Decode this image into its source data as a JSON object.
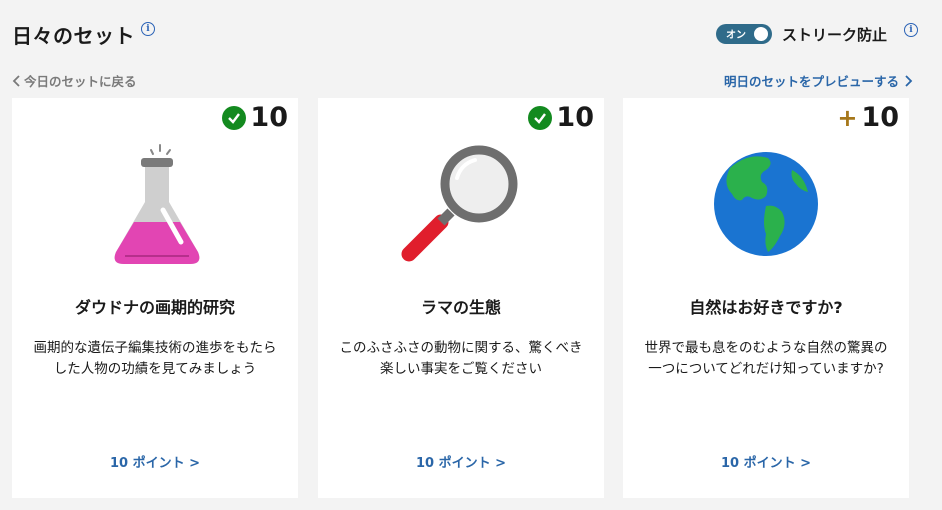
{
  "header": {
    "title": "日々のセット",
    "toggle_label": "オン",
    "streak_label": "ストリーク防止"
  },
  "nav": {
    "back_label": "今日のセットに戻る",
    "preview_label": "明日のセットをプレビューする"
  },
  "cards": [
    {
      "points_label": "10",
      "status": "completed",
      "icon": "flask-icon",
      "title": "ダウドナの画期的研究",
      "description": "画期的な遺伝子編集技術の進歩をもたらした人物の功績を見てみましょう",
      "link": "10 ポイント >"
    },
    {
      "points_label": "10",
      "status": "completed",
      "icon": "magnifier-icon",
      "title": "ラマの生態",
      "description": "このふさふさの動物に関する、驚くべき楽しい事実をご覧ください",
      "link": "10 ポイント >"
    },
    {
      "points_label": "10",
      "status": "available",
      "icon": "globe-icon",
      "title": "自然はお好きですか?",
      "description": "世界で最も息をのむような自然の驚異の一つについてどれだけ知っていますか?",
      "link": "10 ポイント >"
    }
  ],
  "colors": {
    "accent": "#2a66a8",
    "toggle": "#2f6b8a",
    "check": "#138a1f",
    "plus": "#a6771a"
  }
}
